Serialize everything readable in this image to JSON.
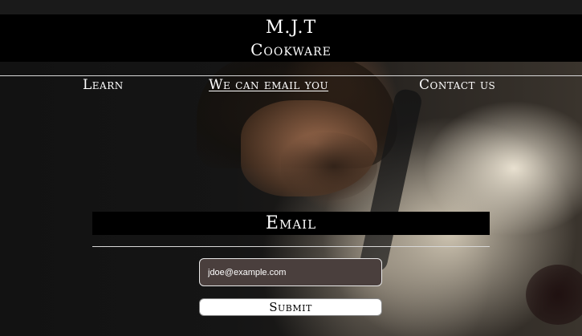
{
  "brand": {
    "line1": "M.J.T",
    "line2": "Cookware"
  },
  "nav": {
    "items": [
      {
        "label": "Learn",
        "active": false
      },
      {
        "label": "We can email you",
        "active": true
      },
      {
        "label": "Contact us",
        "active": false
      }
    ]
  },
  "form": {
    "heading": "Email",
    "email_placeholder": "jdoe@example.com",
    "submit_label": "Submit"
  }
}
